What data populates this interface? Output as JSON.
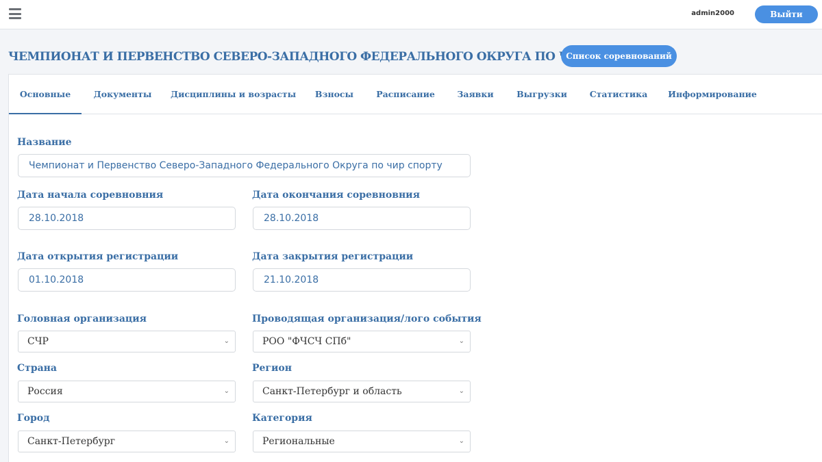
{
  "header": {
    "username": "admin2000",
    "logout_label": "Выйти"
  },
  "page": {
    "title": "ЧЕМПИОНАТ И ПЕРВЕНСТВО СЕВЕРО-ЗАПАДНОГО ФЕДЕРАЛЬНОГО ОКРУГА ПО ЧИР СПОРТУ",
    "competition_list_label": "Список соревнований"
  },
  "tabs": [
    {
      "label": "Основные",
      "active": true
    },
    {
      "label": "Документы"
    },
    {
      "label": "Дисциплины и возрасты"
    },
    {
      "label": "Взносы"
    },
    {
      "label": "Расписание"
    },
    {
      "label": "Заявки"
    },
    {
      "label": "Выгрузки"
    },
    {
      "label": "Статистика"
    },
    {
      "label": "Информирование"
    }
  ],
  "form": {
    "name": {
      "label": "Название",
      "value": "Чемпионат и Первенство Северо-Западного  Федерального Округа по чир спорту"
    },
    "start_date": {
      "label": "Дата начала соревновния",
      "value": "28.10.2018"
    },
    "end_date": {
      "label": "Дата окончания соревновния",
      "value": "28.10.2018"
    },
    "reg_open": {
      "label": "Дата открытия регистрации",
      "value": "01.10.2018"
    },
    "reg_close": {
      "label": "Дата закрытия регистрации",
      "value": "21.10.2018"
    },
    "head_org": {
      "label": "Головная организация",
      "value": "СЧР"
    },
    "host_org": {
      "label": "Проводящая организация/лого события",
      "value": "РОО \"ФЧСЧ СПб\""
    },
    "country": {
      "label": "Страна",
      "value": "Россия"
    },
    "region": {
      "label": "Регион",
      "value": "Санкт-Петербург и область"
    },
    "city": {
      "label": "Город",
      "value": "Санкт-Петербург"
    },
    "category": {
      "label": "Категория",
      "value": "Региональные"
    }
  },
  "icons": {
    "menu": "hamburger-menu-icon",
    "dropdown": "chevron-down-icon"
  },
  "colors": {
    "accent": "#4a90e2",
    "text": "#3a6ea5",
    "background": "#f3f5f8"
  }
}
